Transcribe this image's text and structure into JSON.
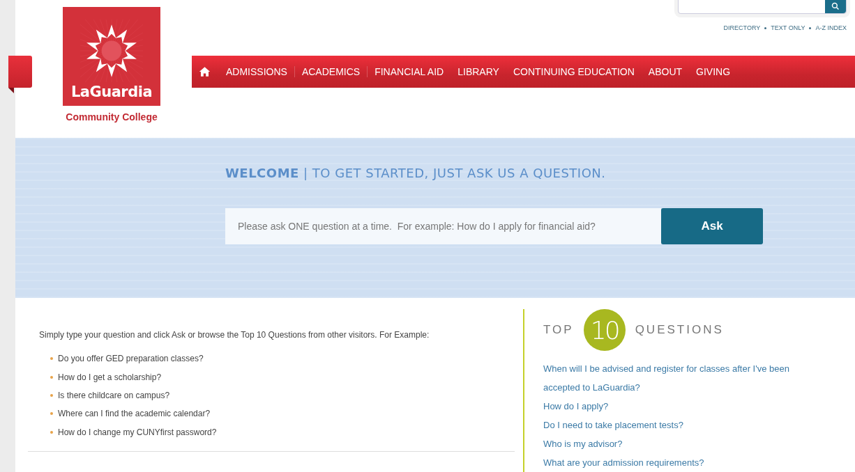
{
  "logo": {
    "name": "LaGuardia",
    "subtitle": "Community College"
  },
  "utility_links": [
    "DIRECTORY",
    "TEXT ONLY",
    "A-Z INDEX"
  ],
  "nav": [
    "ADMISSIONS",
    "ACADEMICS",
    "FINANCIAL AID",
    "LIBRARY",
    "CONTINUING EDUCATION",
    "ABOUT",
    "GIVING"
  ],
  "hero": {
    "heading": "**WELCOME** | TO GET STARTED, JUST ASK US A QUESTION.",
    "question_placeholder": "Please ask ONE question at a time.  For example: How do I apply for financial aid?",
    "ask_button": "Ask"
  },
  "intro": "Simply type your question and click Ask or browse the Top 10 Questions from other visitors. For Example:",
  "examples": [
    "Do you offer GED preparation classes?",
    "How do I get a scholarship?",
    "Is there childcare on campus?",
    "Where can I find the academic calendar?",
    "How do I change my CUNYfirst password?"
  ],
  "top_questions": {
    "title_left": "TOP",
    "badge": "10",
    "title_right": "QUESTIONS",
    "links": [
      "When will I be advised and register for classes after I've been accepted to LaGuardia?",
      "How do I apply?",
      "Do I need to take placement tests?",
      "Who is my advisor?",
      "What are your admission requirements?"
    ]
  }
}
